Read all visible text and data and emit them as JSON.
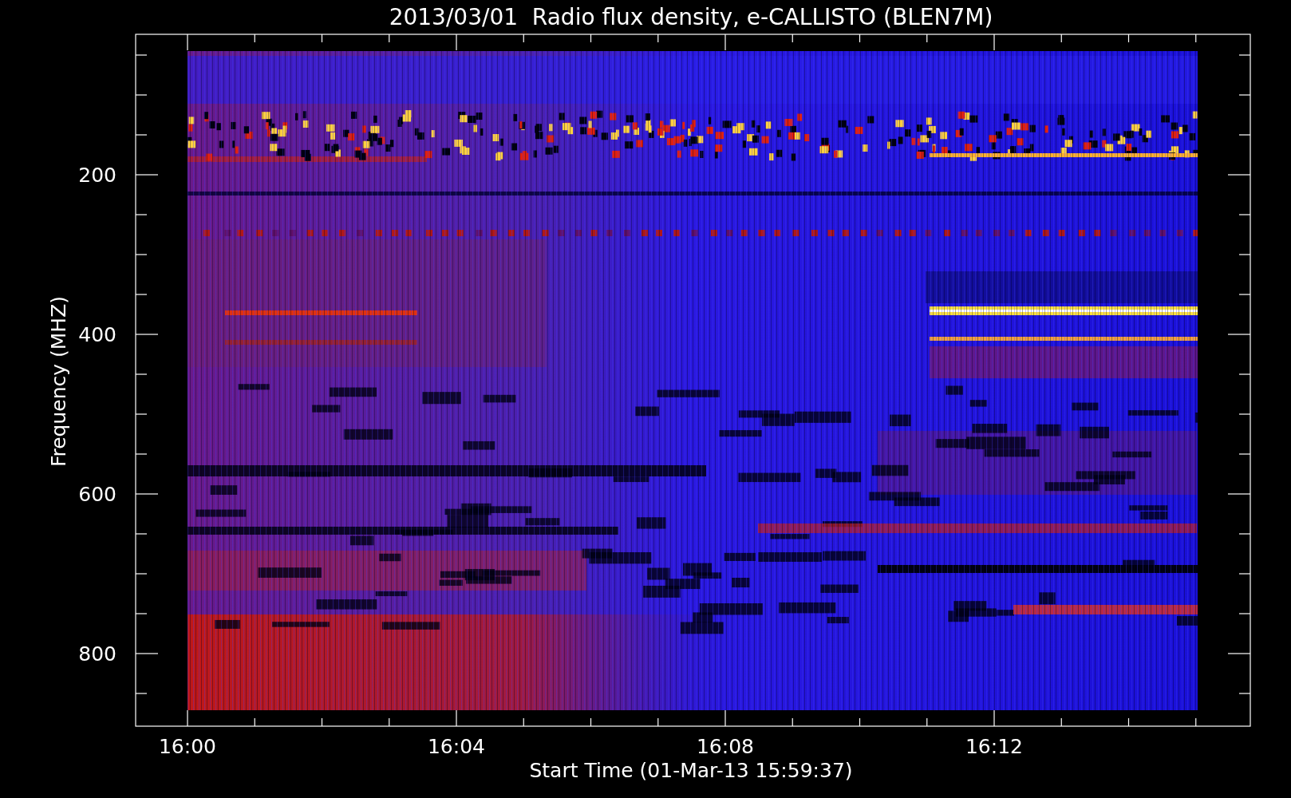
{
  "title": "2013/03/01  Radio flux density, e-CALLISTO (BLEN7M)",
  "plot": {
    "xlabel": "Start Time (01-Mar-13 15:59:37)",
    "ylabel": "Frequency (MHZ)",
    "xticks": [
      "16:00",
      "16:04",
      "16:08",
      "16:12"
    ],
    "yticks": [
      "200",
      "400",
      "600",
      "800"
    ]
  }
}
